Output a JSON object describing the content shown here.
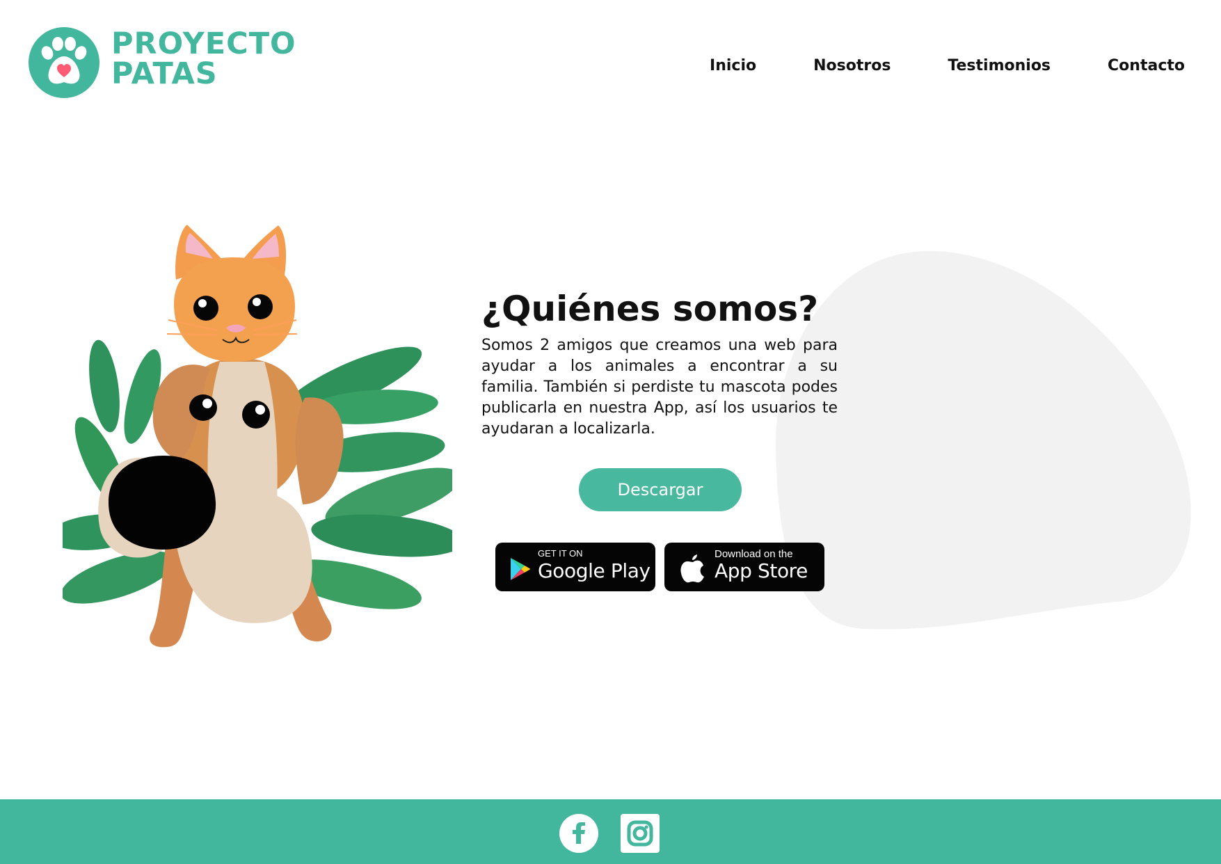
{
  "brand": {
    "name_line1": "PROYECTO",
    "name_line2": "PATAS",
    "logo_icon": "paw-heart-icon",
    "color": "#42b79d"
  },
  "nav": {
    "items": [
      {
        "label": "Inicio"
      },
      {
        "label": "Nosotros"
      },
      {
        "label": "Testimonios"
      },
      {
        "label": "Contacto"
      }
    ]
  },
  "hero": {
    "title": "¿Quiénes somos?",
    "description": "Somos 2 amigos que creamos una web para ayudar a los animales a encontrar a su familia. También si perdiste tu mascota podes publicarla en nuestra App, así los usuarios te ayudaran a localizarla.",
    "cta_label": "Descargar",
    "cta_color": "#48b99f"
  },
  "stores": {
    "google": {
      "small": "GET IT ON",
      "large": "Google Play",
      "icon": "google-play-icon"
    },
    "apple": {
      "small": "Download on the",
      "large": "App Store",
      "icon": "apple-icon"
    }
  },
  "footer": {
    "background": "#42b79d",
    "social": [
      {
        "icon": "facebook-icon"
      },
      {
        "icon": "instagram-icon"
      }
    ]
  }
}
